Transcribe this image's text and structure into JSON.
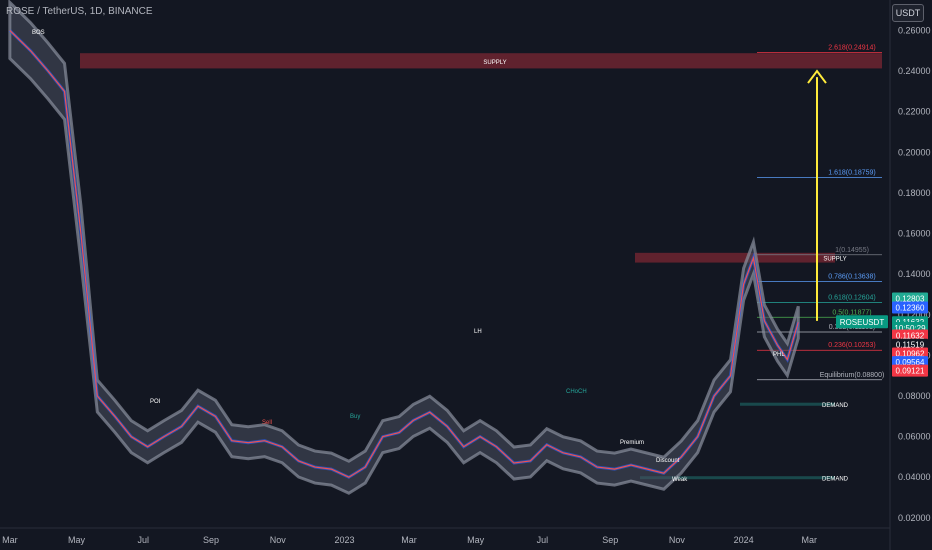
{
  "header": {
    "title": "ROSE / TetherUS, 1D, BINANCE",
    "currency_button": "USDT"
  },
  "chart_data": {
    "type": "line",
    "title": "ROSE / TetherUS, 1D, BINANCE",
    "y_axis": {
      "ylim": [
        0.015,
        0.275
      ],
      "ticks": [
        "0.26000",
        "0.24000",
        "0.22000",
        "0.20000",
        "0.18000",
        "0.16000",
        "0.14000",
        "0.12000",
        "0.10000",
        "0.08000",
        "0.06000",
        "0.04000",
        "0.02000"
      ]
    },
    "x_axis": {
      "labels": [
        "Mar",
        "May",
        "Jul",
        "Sep",
        "Nov",
        "2023",
        "Mar",
        "May",
        "Jul",
        "Sep",
        "Nov",
        "2024",
        "Mar"
      ]
    },
    "series": [
      {
        "x": [
          "2022-03-01",
          "2022-03-20",
          "2022-04-05",
          "2022-04-20",
          "2022-05-05",
          "2022-05-20",
          "2022-06-05",
          "2022-06-20",
          "2022-07-05",
          "2022-07-20",
          "2022-08-05",
          "2022-08-20",
          "2022-09-05",
          "2022-09-20",
          "2022-10-05",
          "2022-10-20",
          "2022-11-05",
          "2022-11-20",
          "2022-12-05",
          "2022-12-20",
          "2023-01-05",
          "2023-01-20",
          "2023-02-05",
          "2023-02-20",
          "2023-03-05",
          "2023-03-20",
          "2023-04-05",
          "2023-04-20",
          "2023-05-05",
          "2023-05-20",
          "2023-06-05",
          "2023-06-20",
          "2023-07-05",
          "2023-07-20",
          "2023-08-05",
          "2023-08-20",
          "2023-09-05",
          "2023-09-20",
          "2023-10-05",
          "2023-10-20",
          "2023-11-05",
          "2023-11-20",
          "2023-12-05",
          "2023-12-20",
          "2024-01-01",
          "2024-01-10",
          "2024-01-20",
          "2024-02-01",
          "2024-02-10",
          "2024-02-20"
        ],
        "values": [
          0.26,
          0.25,
          0.24,
          0.23,
          0.16,
          0.08,
          0.07,
          0.06,
          0.055,
          0.06,
          0.065,
          0.075,
          0.07,
          0.058,
          0.057,
          0.058,
          0.055,
          0.048,
          0.045,
          0.044,
          0.04,
          0.045,
          0.06,
          0.062,
          0.068,
          0.072,
          0.065,
          0.055,
          0.06,
          0.055,
          0.047,
          0.048,
          0.056,
          0.052,
          0.05,
          0.045,
          0.044,
          0.046,
          0.044,
          0.042,
          0.05,
          0.06,
          0.08,
          0.09,
          0.135,
          0.148,
          0.117,
          0.105,
          0.098,
          0.11632
        ]
      }
    ],
    "price_tags": [
      {
        "text": "0.12803",
        "value": 0.12803,
        "color": "#22ab94"
      },
      {
        "text": "0.12360",
        "value": 0.1236,
        "color": "#2962ff"
      },
      {
        "text": "0.11632",
        "value": 0.11632,
        "color": "#089981"
      },
      {
        "text": "10:50:29",
        "value": 0.1135,
        "color": "#089981"
      },
      {
        "text": "0.11632",
        "value": 0.1098,
        "color": "#f23645"
      },
      {
        "text": "0.11519",
        "value": 0.10525,
        "color": "#131722"
      },
      {
        "text": "0.10962",
        "value": 0.10095,
        "color": "#f23645"
      },
      {
        "text": "0.09564",
        "value": 0.0967,
        "color": "#2962ff"
      },
      {
        "text": "0.09121",
        "value": 0.0925,
        "color": "#f23645"
      }
    ],
    "last_label": {
      "text": "ROSEUSDT",
      "value": 0.11632
    },
    "fib_levels": [
      {
        "label": "2.618(0.24914)",
        "value": 0.24914,
        "color": "#f23645"
      },
      {
        "label": "1.618(0.18759)",
        "value": 0.18759,
        "color": "#5b9cf6"
      },
      {
        "label": "1(0.14955)",
        "value": 0.14955,
        "color": "#787b86"
      },
      {
        "label": "0.786(0.13638)",
        "value": 0.13638,
        "color": "#5b9cf6"
      },
      {
        "label": "0.618(0.12604)",
        "value": 0.12604,
        "color": "#26a69a"
      },
      {
        "label": "0.5(0.11877)",
        "value": 0.11877,
        "color": "#4caf50"
      },
      {
        "label": "0.382(0.11151)",
        "value": 0.11151,
        "color": "#b2b5be"
      },
      {
        "label": "0.236(0.10253)",
        "value": 0.10253,
        "color": "#f23645"
      },
      {
        "label": "Equilibrium(0.08800)",
        "value": 0.088,
        "color": "#b2b5be"
      }
    ],
    "zones": [
      {
        "label": "SUPPLY",
        "from": 0.2413,
        "to": 0.2488,
        "color": "#f23645"
      },
      {
        "label": "SUPPLY",
        "from": 0.1457,
        "to": 0.1505,
        "color": "#f23645"
      },
      {
        "label": "DEMAND",
        "from": 0.0752,
        "to": 0.0767,
        "color": "#26a69a"
      },
      {
        "label": "DEMAND",
        "from": 0.0393,
        "to": 0.0405,
        "color": "#26a69a"
      }
    ],
    "annotations": [
      "BOS",
      "POI",
      "Sell",
      "Buy",
      "LH",
      "CHoCH",
      "Premium",
      "Discount",
      "Weak",
      "PHL"
    ],
    "target_arrow": {
      "from": 0.117,
      "to": 0.24
    }
  }
}
